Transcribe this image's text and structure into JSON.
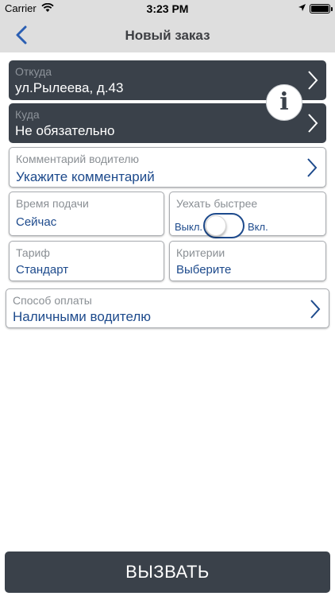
{
  "status_bar": {
    "carrier": "Carrier",
    "time": "3:23 PM",
    "battery_level": 1.0,
    "icons": [
      "wifi-icon",
      "location-arrow-icon",
      "battery-icon"
    ]
  },
  "nav": {
    "title": "Новый заказ",
    "back_icon": "chevron-left-icon"
  },
  "from": {
    "label": "Откуда",
    "value": "ул.Рылеева,  д.43"
  },
  "to": {
    "label": "Куда",
    "value": "Не обязательно"
  },
  "info_icon": {
    "glyph": "i",
    "icon": "info-icon"
  },
  "comment": {
    "label": "Комментарий водителю",
    "value": "Укажите комментарий"
  },
  "pickup_time": {
    "label": "Время подачи",
    "value": "Сейчас"
  },
  "faster": {
    "label": "Уехать быстрее",
    "off_label": "Выкл.",
    "on_label": "Вкл.",
    "checked": false
  },
  "tariff": {
    "label": "Тариф",
    "value": "Стандарт"
  },
  "criteria": {
    "label": "Критерии",
    "value": "Выберите"
  },
  "payment": {
    "label": "Способ оплаты",
    "value": "Наличными водителю"
  },
  "call_button": {
    "label": "ВЫЗВАТЬ"
  },
  "colors": {
    "dark_card": "#3a414a",
    "accent_blue": "#1d4a8c",
    "bar_gray": "#dedede",
    "label_gray": "#8a8f94"
  }
}
